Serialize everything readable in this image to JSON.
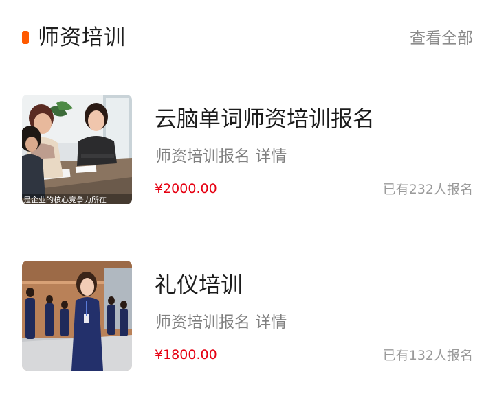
{
  "section": {
    "title": "师资培训",
    "view_all": "查看全部",
    "accent_color": "#ff5a00"
  },
  "courses": [
    {
      "title": "云脑单词师资培训报名",
      "subtitle": "师资培训报名 详情",
      "price": "¥2000.00",
      "enrolled": "已有232人报名",
      "thumbnail_caption": "是企业的核心竞争力所在"
    },
    {
      "title": "礼仪培训",
      "subtitle": "师资培训报名 详情",
      "price": "¥1800.00",
      "enrolled": "已有132人报名"
    }
  ],
  "colors": {
    "price": "#e60012",
    "muted": "#8c8c8c"
  }
}
